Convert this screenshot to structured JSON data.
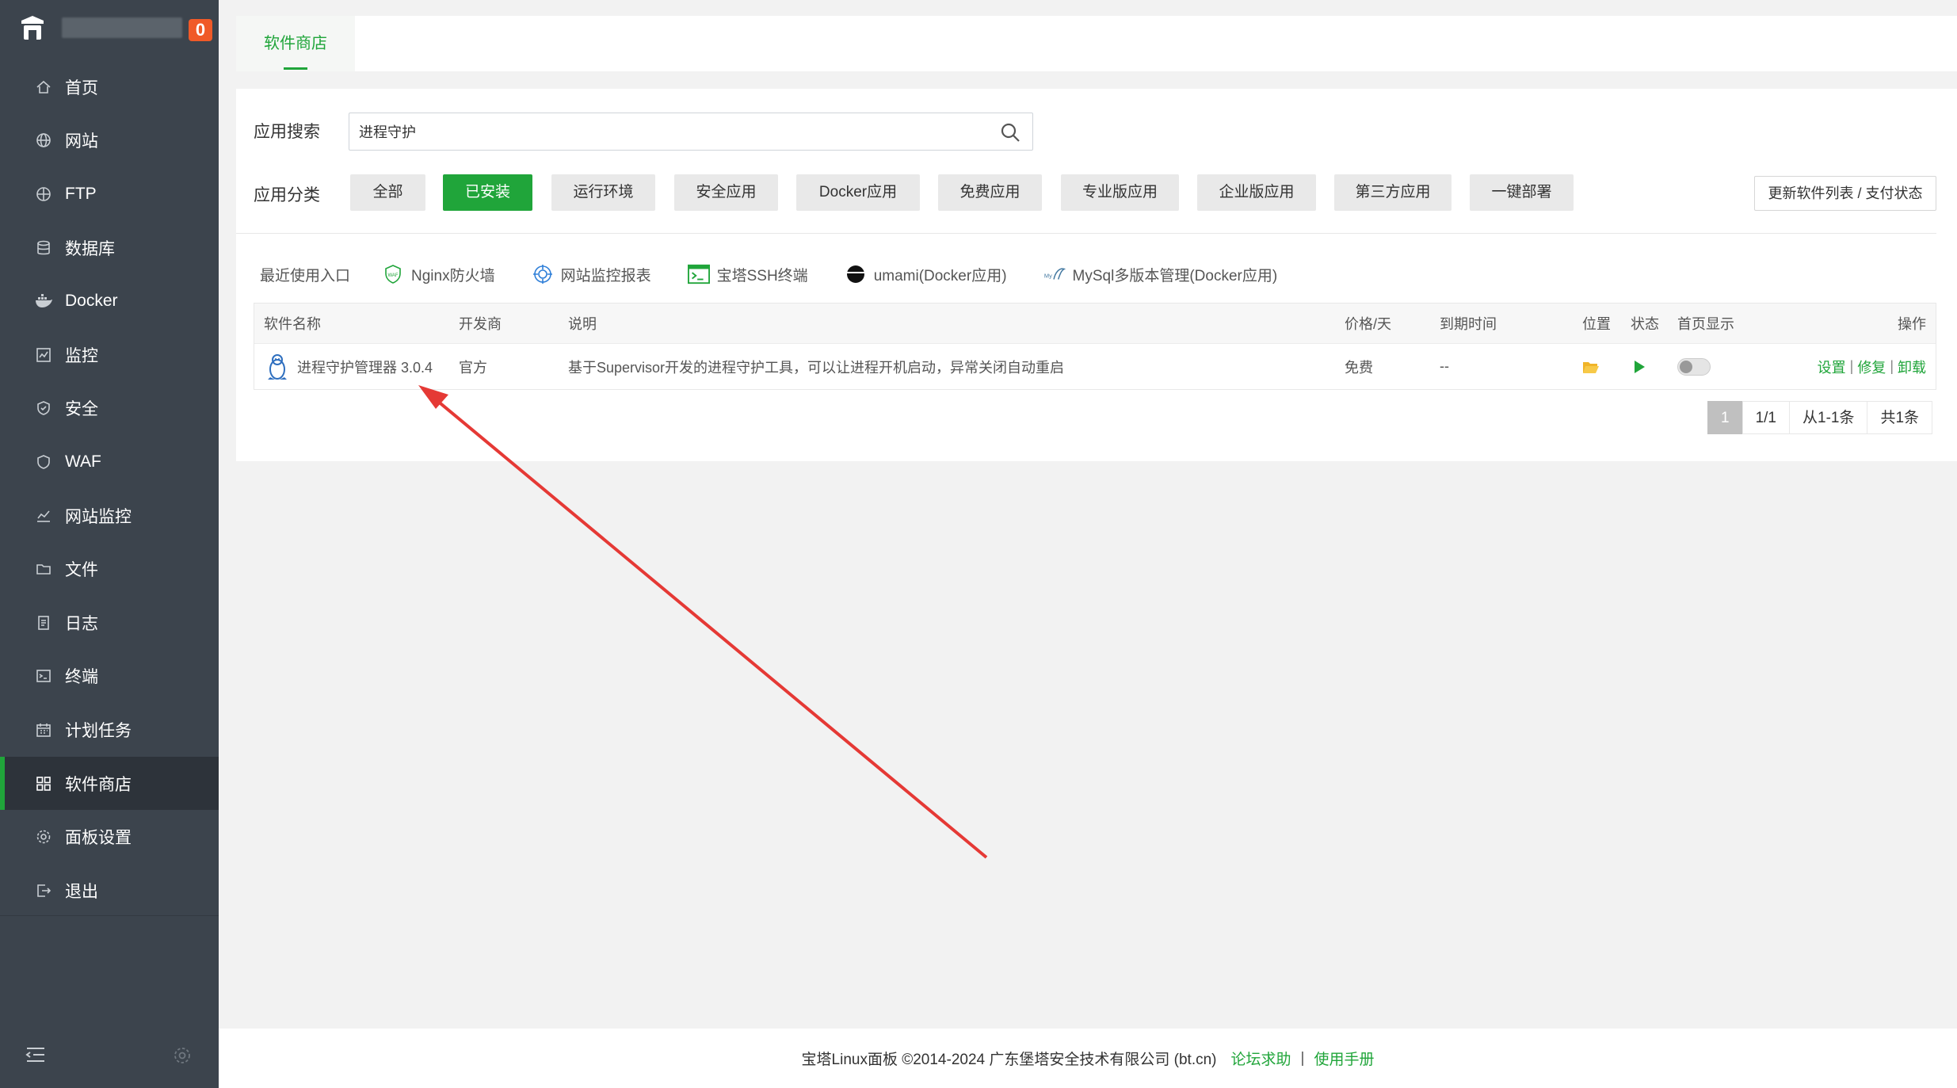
{
  "header": {
    "badge_count": "0"
  },
  "sidebar": {
    "items": [
      {
        "label": "首页",
        "icon": "home-icon"
      },
      {
        "label": "网站",
        "icon": "globe-icon"
      },
      {
        "label": "FTP",
        "icon": "ftp-icon"
      },
      {
        "label": "数据库",
        "icon": "database-icon"
      },
      {
        "label": "Docker",
        "icon": "docker-icon"
      },
      {
        "label": "监控",
        "icon": "monitor-icon"
      },
      {
        "label": "安全",
        "icon": "shield-icon"
      },
      {
        "label": "WAF",
        "icon": "waf-icon"
      },
      {
        "label": "网站监控",
        "icon": "chart-icon"
      },
      {
        "label": "文件",
        "icon": "folder-icon"
      },
      {
        "label": "日志",
        "icon": "log-icon"
      },
      {
        "label": "终端",
        "icon": "terminal-icon"
      },
      {
        "label": "计划任务",
        "icon": "calendar-icon"
      },
      {
        "label": "软件商店",
        "icon": "grid-icon",
        "active": true
      },
      {
        "label": "面板设置",
        "icon": "gear-icon"
      },
      {
        "label": "退出",
        "icon": "logout-icon"
      }
    ]
  },
  "tabs": [
    {
      "label": "软件商店"
    }
  ],
  "search": {
    "label": "应用搜索",
    "value": "进程守护"
  },
  "categories": {
    "label": "应用分类",
    "items": [
      "全部",
      "已安装",
      "运行环境",
      "安全应用",
      "Docker应用",
      "免费应用",
      "专业版应用",
      "企业版应用",
      "第三方应用",
      "一键部署"
    ],
    "active_index": 1,
    "update_label": "更新软件列表 / 支付状态"
  },
  "recent": {
    "label": "最近使用入口",
    "items": [
      "Nginx防火墙",
      "网站监控报表",
      "宝塔SSH终端",
      "umami(Docker应用)",
      "MySql多版本管理(Docker应用)"
    ]
  },
  "table": {
    "headers": {
      "name": "软件名称",
      "dev": "开发商",
      "desc": "说明",
      "price": "价格/天",
      "expire": "到期时间",
      "location": "位置",
      "status": "状态",
      "home": "首页显示",
      "ops": "操作"
    },
    "rows": [
      {
        "name": "进程守护管理器 3.0.4",
        "dev": "官方",
        "desc": "基于Supervisor开发的进程守护工具，可以让进程开机启动，异常关闭自动重启",
        "price": "免费",
        "expire": "--",
        "ops": [
          "设置",
          "修复",
          "卸载"
        ]
      }
    ]
  },
  "pager": {
    "current": "1",
    "pages": "1/1",
    "range": "从1-1条",
    "total": "共1条"
  },
  "footer": {
    "copyright": "宝塔Linux面板 ©2014-2024 广东堡塔安全技术有限公司 (bt.cn)",
    "forum": "论坛求助",
    "manual": "使用手册"
  },
  "colors": {
    "accent": "#20a53a",
    "sidebar": "#3c444d",
    "badge": "#f05a28",
    "annotation": "#e53935"
  }
}
